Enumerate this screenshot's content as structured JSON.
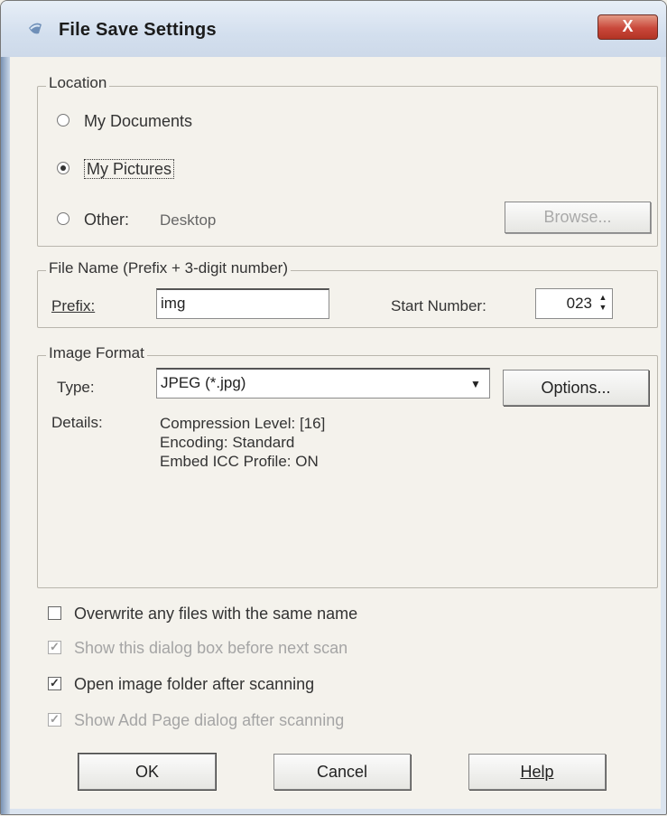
{
  "window": {
    "title": "File Save Settings",
    "close_glyph": "X"
  },
  "location": {
    "group_label": "Location",
    "options": [
      {
        "label": "My Documents",
        "selected": false
      },
      {
        "label": "My Pictures",
        "selected": true
      },
      {
        "label": "Other:",
        "selected": false
      }
    ],
    "other_path": "Desktop",
    "browse_label": "Browse..."
  },
  "file_name": {
    "group_label": "File Name (Prefix + 3-digit number)",
    "prefix_label": "Prefix:",
    "prefix_value": "img",
    "start_number_label": "Start Number:",
    "start_number_value": "023"
  },
  "image_format": {
    "group_label": "Image Format",
    "type_label": "Type:",
    "type_value": "JPEG (*.jpg)",
    "options_label": "Options...",
    "details_label": "Details:",
    "details": [
      "Compression Level: [16]",
      "Encoding: Standard",
      "Embed ICC Profile: ON"
    ]
  },
  "checkboxes": [
    {
      "label": "Overwrite any files with the same name",
      "checked": false,
      "enabled": true
    },
    {
      "label": "Show this dialog box before next scan",
      "checked": true,
      "enabled": false
    },
    {
      "label": "Open image folder after scanning",
      "checked": true,
      "enabled": true
    },
    {
      "label": "Show Add Page dialog after scanning",
      "checked": true,
      "enabled": false
    }
  ],
  "buttons": {
    "ok": "OK",
    "cancel": "Cancel",
    "help": "Help"
  },
  "colors": {
    "close_button": "#c9473a",
    "title_bar": "#d3dfee"
  }
}
